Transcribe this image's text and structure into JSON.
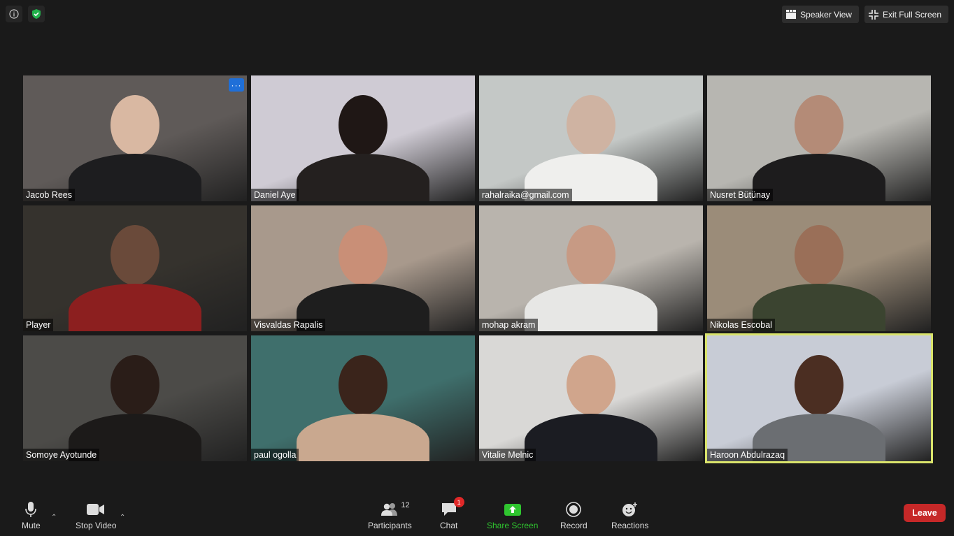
{
  "top_bar": {
    "speaker_view_label": "Speaker View",
    "exit_full_screen_label": "Exit Full Screen"
  },
  "participants_grid": [
    {
      "name": "Jacob Rees",
      "bg": "#5f5a58",
      "skin": "#d9b8a2",
      "shirt": "#1d1d1f",
      "more_label": "···"
    },
    {
      "name": "Daniel Aye",
      "bg": "#cfcbd4",
      "skin": "#1f1715",
      "shirt": "#24201f"
    },
    {
      "name": "rahalraika@gmail.com",
      "bg": "#c4c8c6",
      "skin": "#cfb3a2",
      "shirt": "#efefed"
    },
    {
      "name": "Nusret Bütünay",
      "bg": "#b7b6b1",
      "skin": "#b48b77",
      "shirt": "#1d1c1d"
    },
    {
      "name": "Player",
      "bg": "#35322d",
      "skin": "#6a4a3a",
      "shirt": "#8c1f1f"
    },
    {
      "name": "Visvaldas Rapalis",
      "bg": "#a8998c",
      "skin": "#c98f77",
      "shirt": "#1e1e1e"
    },
    {
      "name": "mohap akram",
      "bg": "#b9b4ad",
      "skin": "#c79a84",
      "shirt": "#e7e7e5"
    },
    {
      "name": "Nikolas Escobal",
      "bg": "#9b8c79",
      "skin": "#9a6f58",
      "shirt": "#3b4430"
    },
    {
      "name": "Somoye Ayotunde",
      "bg": "#4c4b48",
      "skin": "#2a1d18",
      "shirt": "#1c1a19"
    },
    {
      "name": "paul ogolla",
      "bg": "#3f6f6c",
      "skin": "#3a241b",
      "shirt": "#c9a88f"
    },
    {
      "name": "Vitalie Melnic",
      "bg": "#d9d8d6",
      "skin": "#d0a58c",
      "shirt": "#1b1c22"
    },
    {
      "name": "Haroon Abdulrazaq",
      "bg": "#c8ccd6",
      "skin": "#4b2e22",
      "shirt": "#6b6e72"
    }
  ],
  "bottom_bar": {
    "mute_label": "Mute",
    "stop_video_label": "Stop Video",
    "participants_label": "Participants",
    "participants_count": "12",
    "chat_label": "Chat",
    "chat_badge": "1",
    "share_screen_label": "Share Screen",
    "record_label": "Record",
    "reactions_label": "Reactions",
    "leave_label": "Leave",
    "share_color": "#2fc52f",
    "leave_color": "#c62828"
  }
}
